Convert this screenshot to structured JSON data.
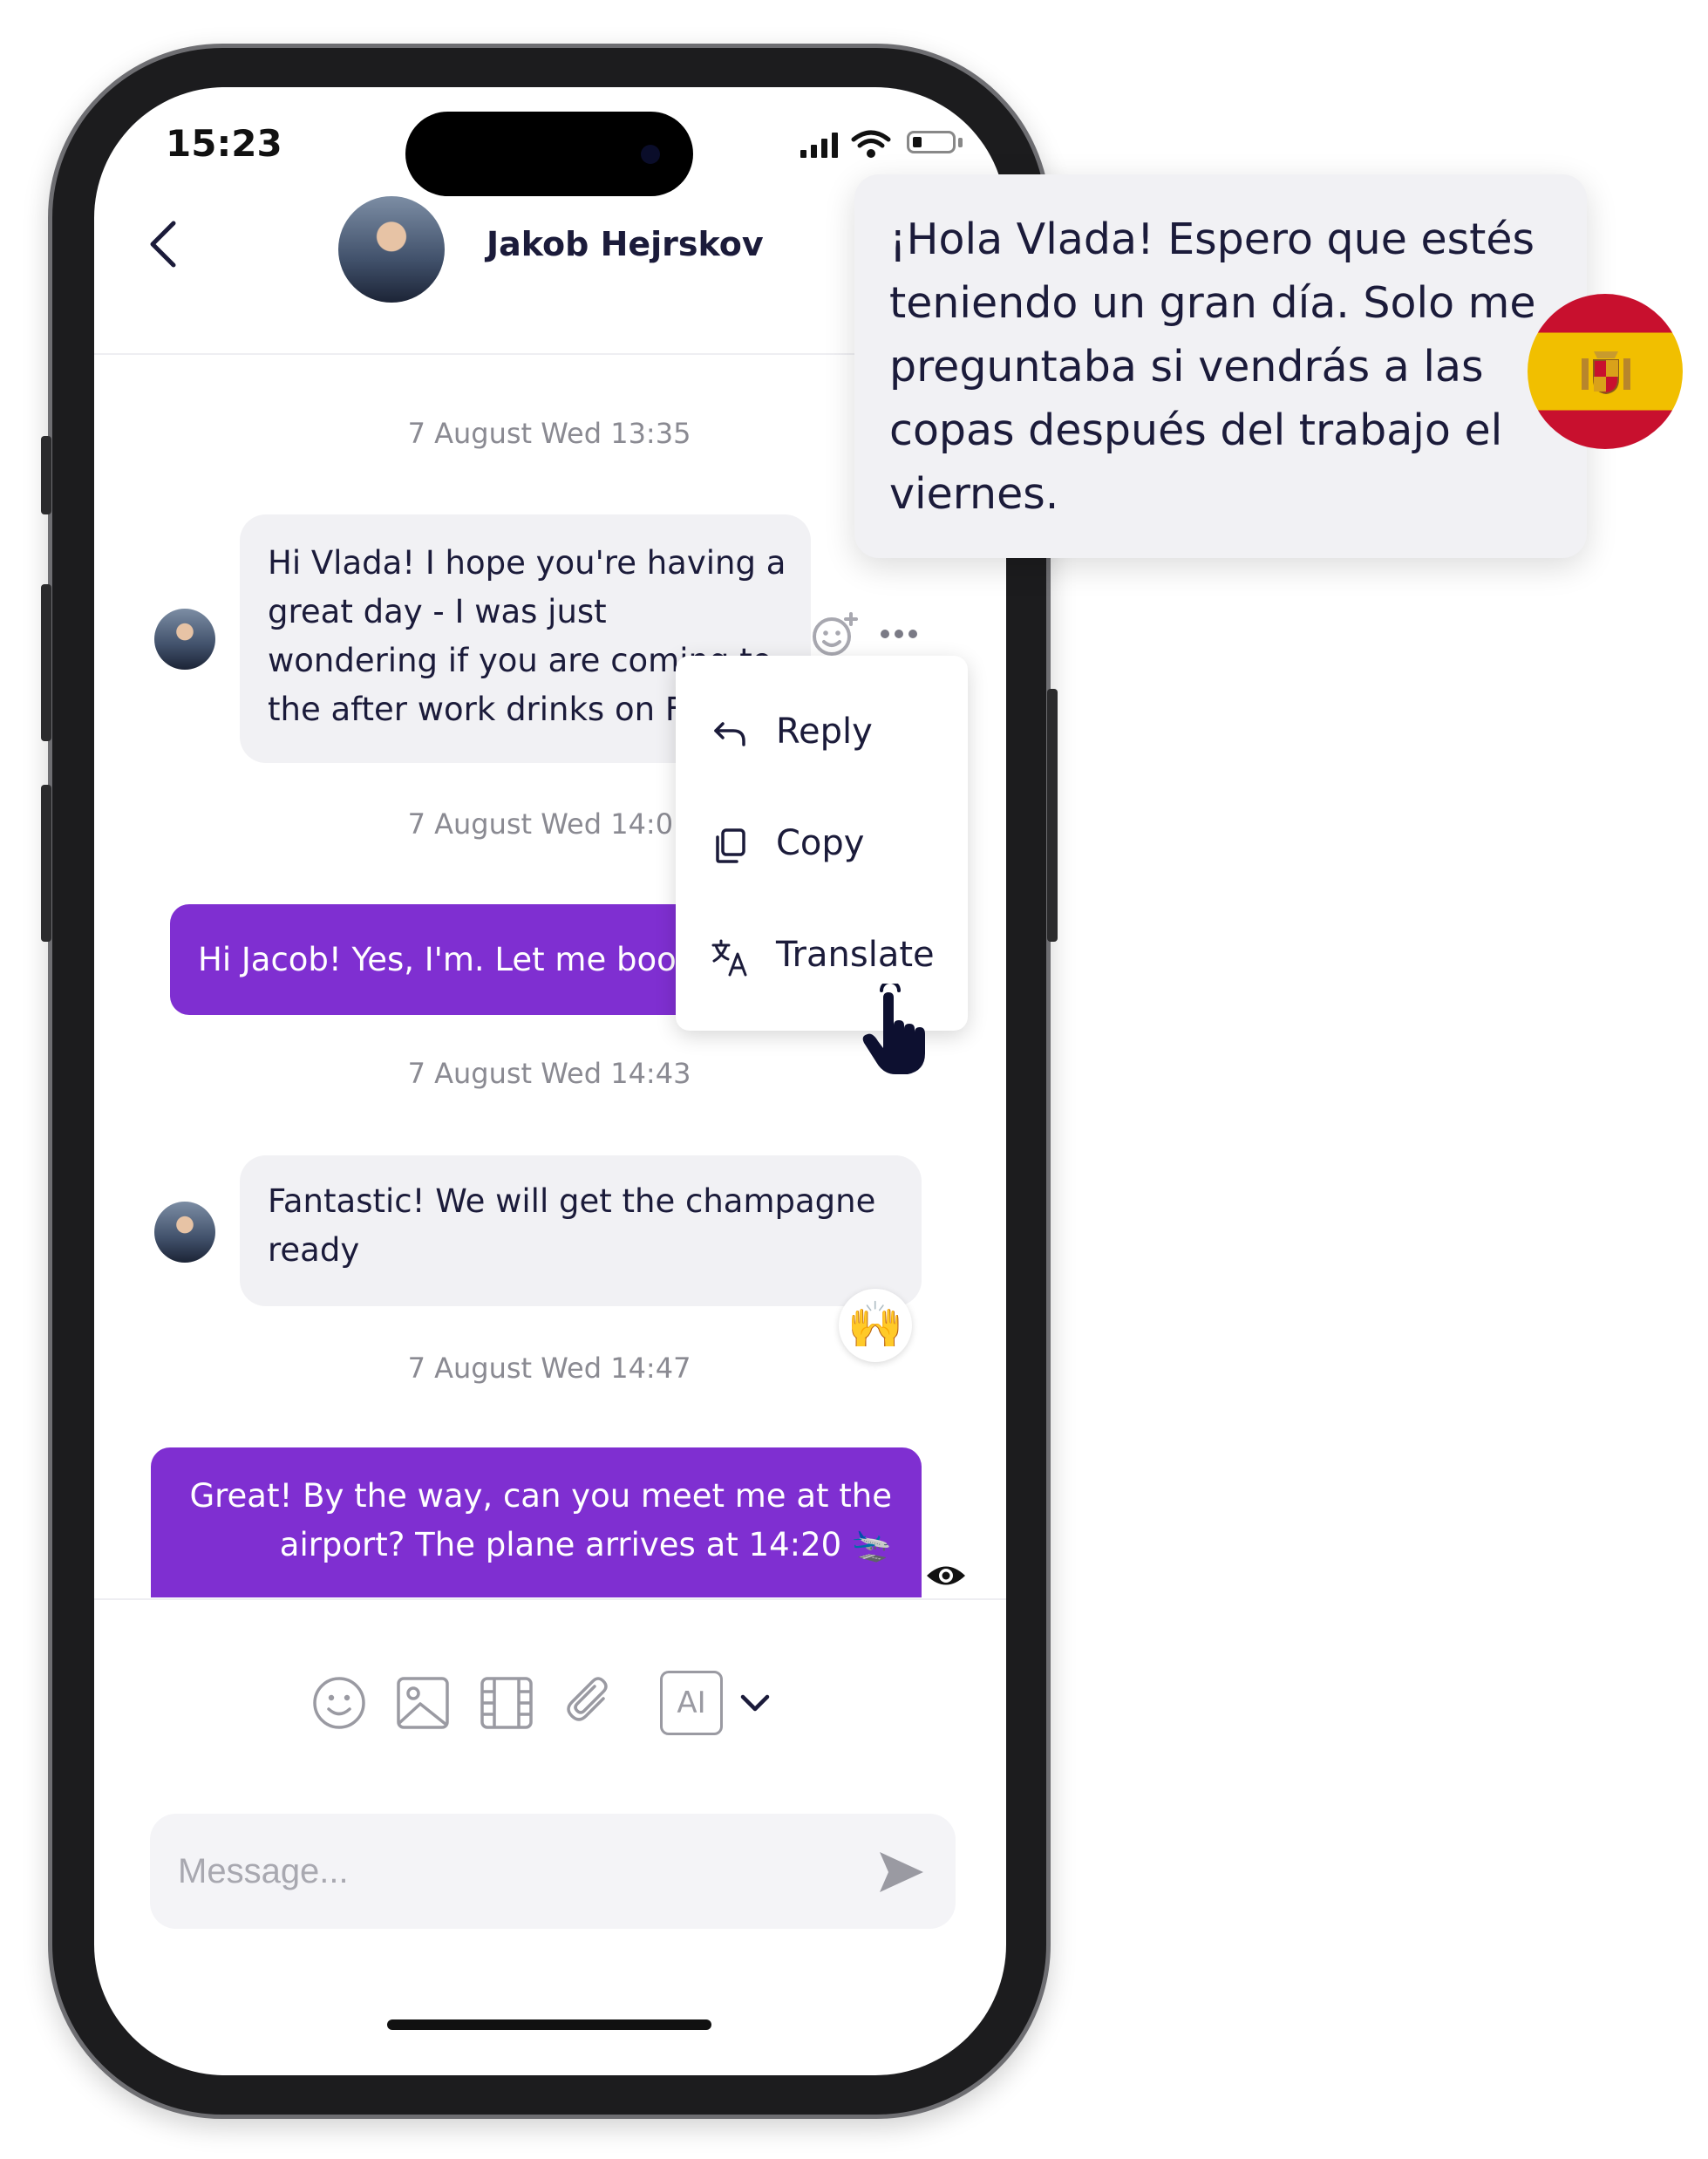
{
  "status_bar": {
    "time": "15:23",
    "icons": [
      "signal-icon",
      "wifi-icon",
      "battery-icon"
    ]
  },
  "header": {
    "contact_name": "Jakob Hejrskov"
  },
  "messages": [
    {
      "timestamp": "7 August Wed 13:35",
      "direction": "in",
      "lines": [
        "Hi Vlada! I hope you're having a",
        "great day - I was just",
        "wondering if you are coming to",
        "the after work drinks on Friday"
      ]
    },
    {
      "timestamp": "7 August Wed 14:01",
      "direction": "out",
      "text": "Hi Jacob! Yes, I'm. Let me book"
    },
    {
      "timestamp": "7 August Wed 14:43",
      "direction": "in",
      "lines": [
        "Fantastic! We will get the champagne",
        "ready"
      ],
      "reaction": "🙌"
    },
    {
      "timestamp": "7 August Wed 14:47",
      "direction": "out",
      "lines": [
        "Great! By the way, can you meet me at the",
        "airport? The plane arrives at 14:20 🛬"
      ]
    }
  ],
  "context_menu": {
    "items": [
      {
        "label": "Reply",
        "icon": "reply-icon"
      },
      {
        "label": "Copy",
        "icon": "copy-icon"
      },
      {
        "label": "Translate",
        "icon": "translate-icon"
      }
    ]
  },
  "composer": {
    "placeholder": "Message...",
    "tools": [
      "emoji-icon",
      "image-icon",
      "video-icon",
      "attachment-icon"
    ],
    "ai_label": "AI"
  },
  "translation": {
    "lines": [
      "¡Hola Vlada! Espero que estés",
      "teniendo un gran día. Solo me",
      "preguntaba si vendrás a las",
      "copas después del trabajo el",
      "viernes."
    ],
    "language_flag": "spain-flag-icon"
  },
  "colors": {
    "accent": "#7f2fd1",
    "incoming_bubble": "#f1f1f4",
    "text_dark": "#1b1b3a",
    "timestamp": "#8a8a92"
  }
}
